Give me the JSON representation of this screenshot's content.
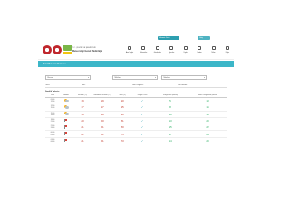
{
  "topbar": {
    "btn1": "Hizmet Girişi",
    "btn2": "Giriş"
  },
  "org": {
    "line1": "T.C. ÇEVRE VE ŞEHİRCİLİK",
    "line2": "Meteoroloji Genel Müdürlüğü"
  },
  "nav": [
    {
      "icon": "home-icon",
      "label": "Ana Sayfa"
    },
    {
      "icon": "forecast-icon",
      "label": "Tahminler"
    },
    {
      "icon": "observation-icon",
      "label": "Gözlemler"
    },
    {
      "icon": "warning-icon",
      "label": "Uyarılar"
    },
    {
      "icon": "satellite-icon",
      "label": "Uydu"
    },
    {
      "icon": "radar-icon",
      "label": "Radar"
    },
    {
      "icon": "climate-icon",
      "label": "İklim"
    },
    {
      "icon": "other-icon",
      "label": "Diğer"
    }
  ],
  "band": {
    "title": "Saatlik Hava Durumu"
  },
  "filters": {
    "province": "Bursa",
    "district": "Nilüfer",
    "center": "Merkez"
  },
  "info": {
    "row": [
      {
        "label": "Tarih:",
        "value": ""
      },
      {
        "label": "Gün:",
        "value": ""
      },
      {
        "label": "Gün Doğumu:",
        "value": ""
      },
      {
        "label": "Gün Batımı:",
        "value": ""
      }
    ]
  },
  "section": "Saatlik Tahmin",
  "table": {
    "headers": [
      "Saat",
      "Hadise",
      "Sıcaklık (°C)",
      "Hissedilen Sıcaklık (°C)",
      "Nem (%)",
      "Rüzgar Yönü",
      "Rüzgar Hızı (km/sa)",
      "Maks. Rüzgar Hızı (km/sa)"
    ],
    "rows": [
      {
        "time": [
          "09:00",
          "12:00"
        ],
        "icon": "partly-cloudy-icon",
        "temp": "19",
        "feels": "19",
        "humidity": "90",
        "speed": "5",
        "max": "13"
      },
      {
        "time": [
          "12:00",
          "15:00"
        ],
        "icon": "partly-cloudy-icon",
        "temp": "17",
        "feels": "17",
        "humidity": "95",
        "speed": "8",
        "max": "15"
      },
      {
        "time": [
          "15:00",
          "18:00"
        ],
        "icon": "partly-cloudy-icon",
        "temp": "18",
        "feels": "18",
        "humidity": "90",
        "speed": "10",
        "max": "18"
      },
      {
        "time": [
          "18:00",
          "21:00"
        ],
        "icon": "windy-flag-icon",
        "temp": "20",
        "feels": "20",
        "humidity": "81",
        "speed": "13",
        "max": "20"
      },
      {
        "time": [
          "21:00",
          "24:00"
        ],
        "icon": "windy-flag-icon",
        "temp": "21",
        "feels": "21",
        "humidity": "80",
        "speed": "15",
        "max": "22"
      },
      {
        "time": [
          "00:00",
          "03:00"
        ],
        "icon": "windy-flag-icon",
        "temp": "21",
        "feels": "21",
        "humidity": "75",
        "speed": "17",
        "max": "24"
      },
      {
        "time": [
          "03:00",
          "06:00"
        ],
        "icon": "windy-flag-icon",
        "temp": "21",
        "feels": "21",
        "humidity": "73",
        "speed": "14",
        "max": "20"
      }
    ]
  },
  "colors": {
    "accent": "#3cb6c8",
    "temperature": "#c0392b",
    "wind": "#27ae60"
  }
}
